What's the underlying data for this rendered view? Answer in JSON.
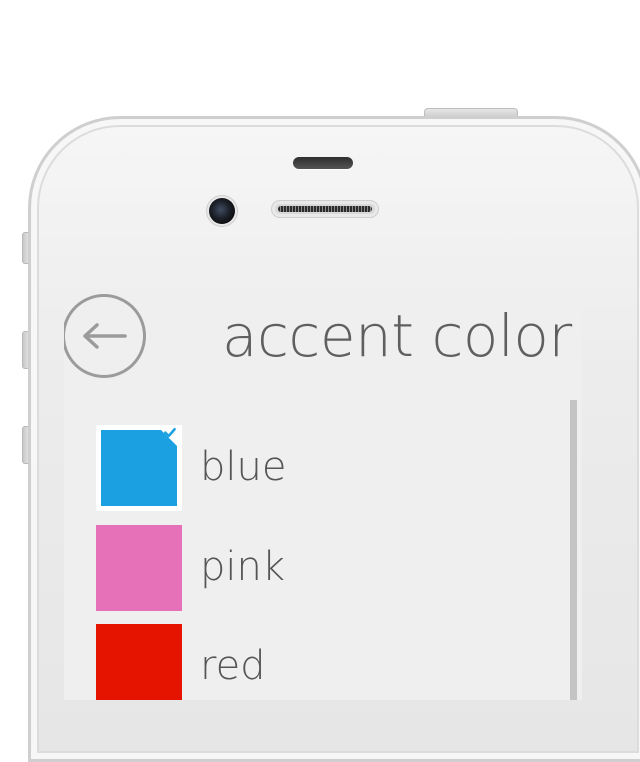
{
  "header": {
    "title": "accent color"
  },
  "colors": [
    {
      "label": "blue",
      "hex": "#1ba1e2",
      "selected": true
    },
    {
      "label": "pink",
      "hex": "#e671b8",
      "selected": false
    },
    {
      "label": "red",
      "hex": "#e51400",
      "selected": false
    }
  ],
  "icons": {
    "back": "arrow-left-icon",
    "selected": "checkmark-icon"
  }
}
